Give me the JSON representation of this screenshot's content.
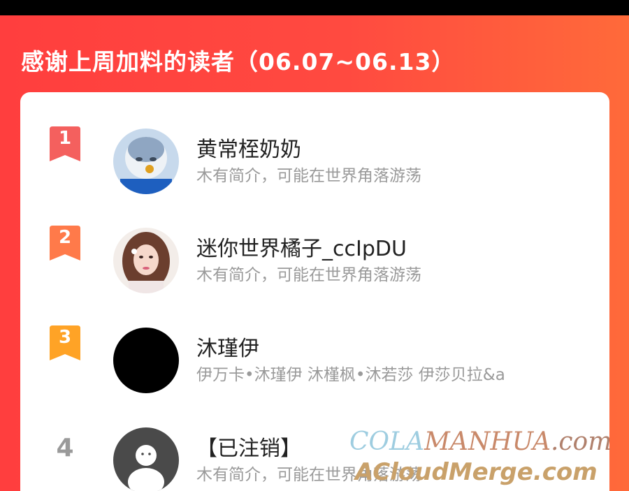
{
  "header": {
    "title": "感谢上周加料的读者（06.07~06.13）"
  },
  "colors": {
    "header_bg": "#ff4a40",
    "rank1": "#f4605e",
    "rank2": "#ff7a4a",
    "rank3": "#ffa326",
    "rank_plain": "#9a9a9a"
  },
  "readers": [
    {
      "rank": "1",
      "name": "黄常桎奶奶",
      "bio": "木有简介，可能在世界角落游荡",
      "avatar": "cartoon-avatar"
    },
    {
      "rank": "2",
      "name": "迷你世界橘子_ccIpDU",
      "bio": "木有简介，可能在世界角落游荡",
      "avatar": "photo-avatar"
    },
    {
      "rank": "3",
      "name": "沐瑾伊",
      "bio": "伊万卡•沐瑾伊 沐槿枫•沐若莎 伊莎贝拉&a",
      "avatar": "black-avatar"
    },
    {
      "rank": "4",
      "name": "【已注销】",
      "bio": "木有简介，可能在世界角落游荡",
      "avatar": "default-avatar"
    }
  ],
  "watermark": {
    "cola": "COLA",
    "manhua": "MANHUA",
    "com": ".com",
    "line2": "ACloudMerge.com"
  }
}
